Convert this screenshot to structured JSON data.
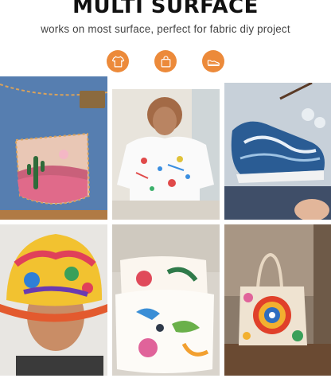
{
  "header": {
    "title": "MULTI SURFACE",
    "subtitle": "works on most surface, perfect for fabric diy project"
  },
  "icons": [
    {
      "name": "tshirt-icon",
      "label": "t-shirt"
    },
    {
      "name": "bag-icon",
      "label": "bag"
    },
    {
      "name": "shoe-icon",
      "label": "shoe"
    }
  ],
  "colors": {
    "accent": "#ec8a3a",
    "title": "#111111",
    "subtitle": "#444444",
    "background": "#ffffff"
  },
  "photos": [
    {
      "name": "photo-denim-pocket",
      "subject": "painted denim jeans pocket with cactus"
    },
    {
      "name": "photo-painted-tshirt",
      "subject": "woman wearing paint-splattered t-shirt"
    },
    {
      "name": "photo-painted-sneaker",
      "subject": "hand painting wave design on sneaker"
    },
    {
      "name": "photo-bucket-hat",
      "subject": "child wearing colorful painted bucket hat"
    },
    {
      "name": "photo-painted-pillows",
      "subject": "pillows painted with birds and leaves"
    },
    {
      "name": "photo-tote-bag",
      "subject": "painted mandala tote bag on table"
    }
  ]
}
